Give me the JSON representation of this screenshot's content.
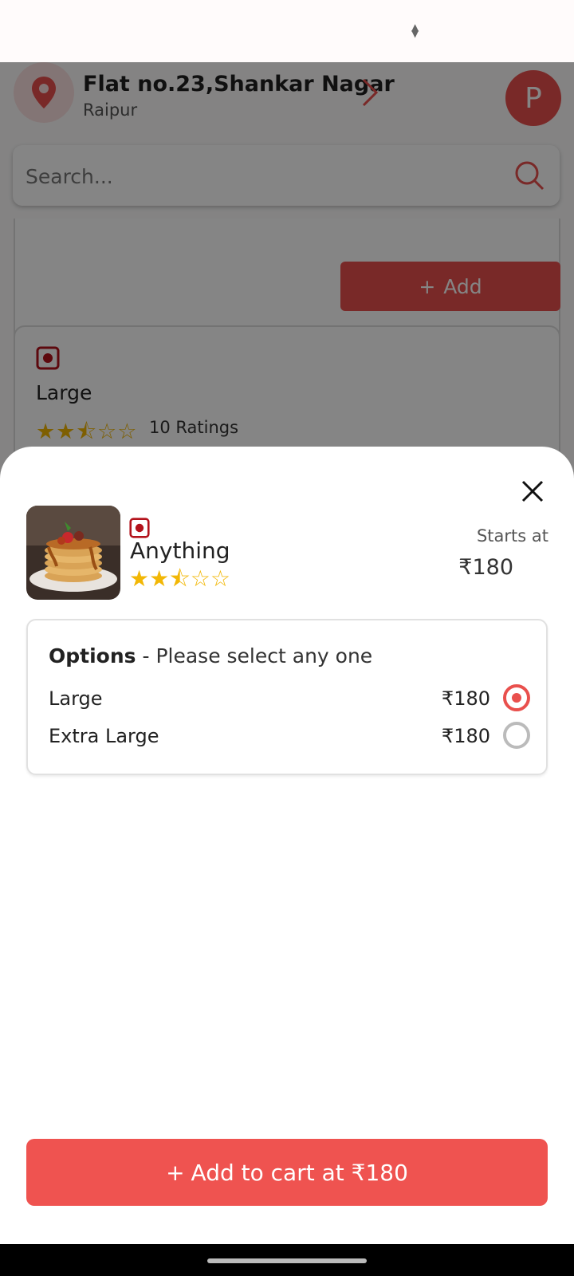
{
  "status_bar": {
    "sort_icon": "sort-arrows-icon"
  },
  "header": {
    "location_title": "Flat no.23,Shankar Nagar",
    "location_sub": "Raipur",
    "avatar_initial": "P",
    "icons": [
      "location-pin-icon",
      "chevron-right-icon"
    ]
  },
  "search": {
    "placeholder": "Search..."
  },
  "list": {
    "add_button": "Add",
    "item_name": "Large",
    "rating_value": 2.5,
    "ratings_text": "10 Ratings"
  },
  "sheet": {
    "item_name": "Anything",
    "rating_value": 2.5,
    "starts_at_label": "Starts at",
    "starts_at_price": "₹180",
    "options_title": "Options",
    "options_subtitle": " - Please select any one",
    "options": [
      {
        "label": "Large",
        "price": "₹180",
        "selected": true
      },
      {
        "label": "Extra Large",
        "price": "₹180",
        "selected": false
      }
    ],
    "cart_button": "Add to cart at ₹180"
  },
  "colors": {
    "accent": "#e9504d",
    "star": "#f2b705",
    "veg_mark": "#b3121b"
  }
}
